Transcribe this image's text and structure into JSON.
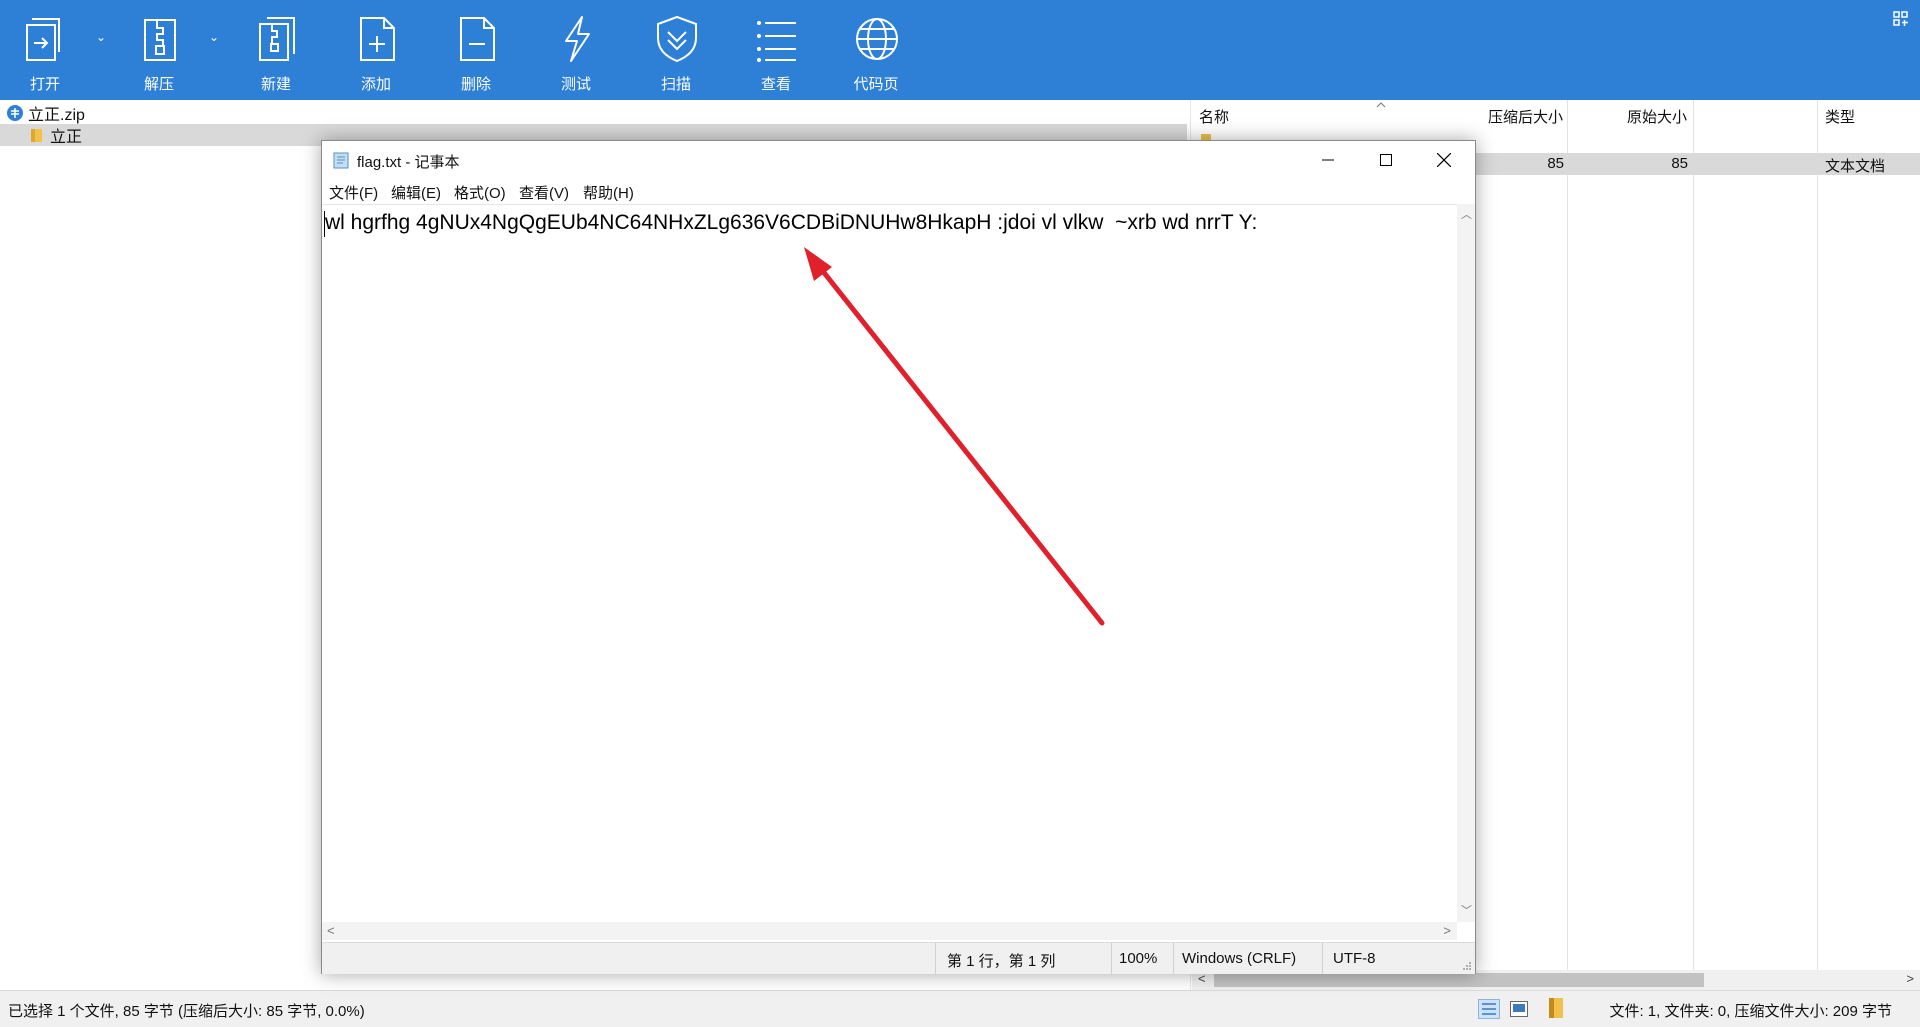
{
  "toolbar": {
    "buttons": [
      {
        "label": "打开",
        "icon": "open-icon"
      },
      {
        "label": "解压",
        "icon": "extract-icon"
      },
      {
        "label": "新建",
        "icon": "new-archive-icon"
      },
      {
        "label": "添加",
        "icon": "add-icon"
      },
      {
        "label": "删除",
        "icon": "delete-icon"
      },
      {
        "label": "测试",
        "icon": "test-lightning-icon"
      },
      {
        "label": "扫描",
        "icon": "scan-shield-icon"
      },
      {
        "label": "查看",
        "icon": "view-list-icon"
      },
      {
        "label": "代码页",
        "icon": "globe-icon"
      }
    ]
  },
  "tree": {
    "root": "立正.zip",
    "child": "立正"
  },
  "list": {
    "headers": {
      "name": "名称",
      "compressed": "压缩后大小",
      "original": "原始大小",
      "type": "类型"
    },
    "row": {
      "compressed": "85",
      "original": "85",
      "type": "文本文档"
    }
  },
  "status": {
    "left": "已选择 1 个文件, 85 字节 (压缩后大小: 85 字节, 0.0%)",
    "right": "文件: 1, 文件夹: 0, 压缩文件大小: 209 字节"
  },
  "notepad": {
    "title": "flag.txt - 记事本",
    "menu": [
      "文件(F)",
      "编辑(E)",
      "格式(O)",
      "查看(V)",
      "帮助(H)"
    ],
    "content": "wl hgrfhg 4gNUx4NgQgEUb4NC64NHxZLg636V6CDBiDNUHw8HkapH :jdoi vl vlkw  ~xrb wd nrrT Y:",
    "status": {
      "position": "第 1 行，第 1 列",
      "zoom": "100%",
      "line_ending": "Windows (CRLF)",
      "encoding": "UTF-8"
    }
  },
  "colors": {
    "toolbar_bg": "#2e7fd6",
    "annotation_arrow": "#e0202a"
  }
}
